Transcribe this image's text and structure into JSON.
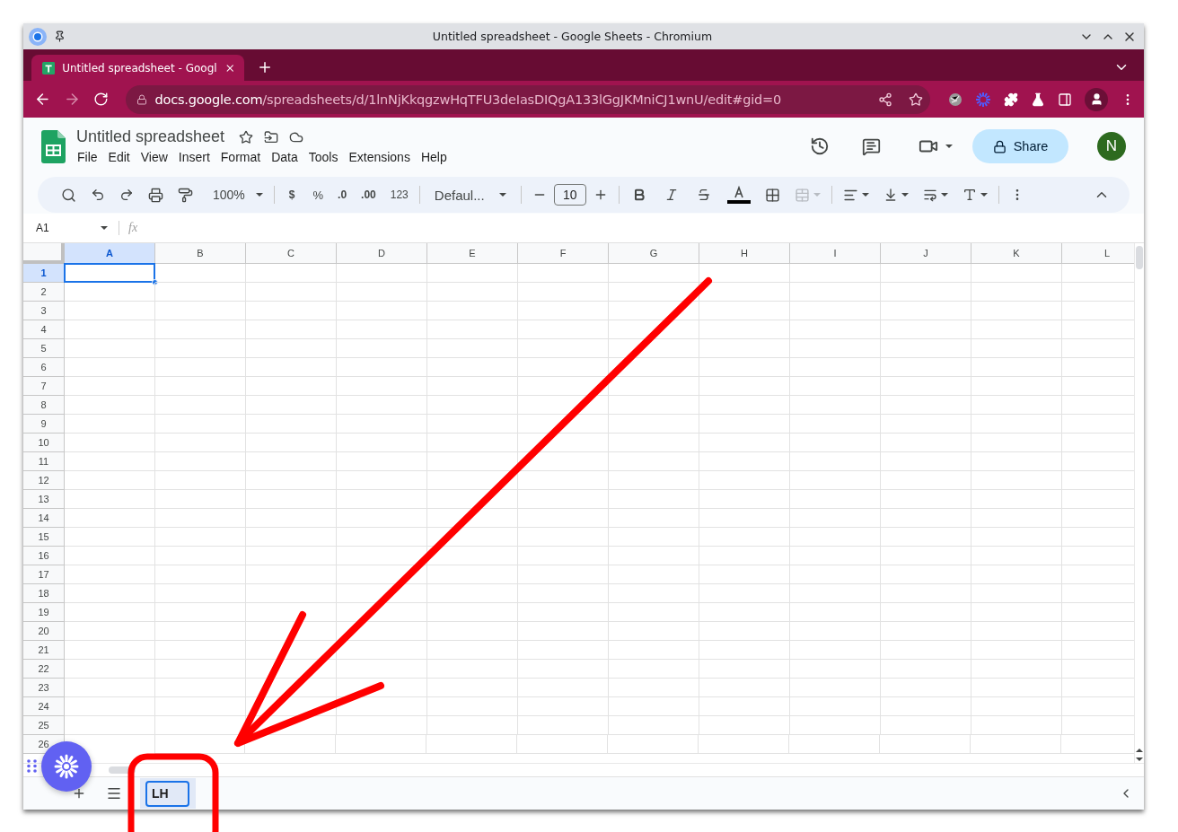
{
  "window": {
    "title": "Untitled spreadsheet - Google Sheets - Chromium"
  },
  "browser": {
    "tab": {
      "title": "Untitled spreadsheet - Googl",
      "selected": true
    },
    "forward": {
      "disabled": true
    },
    "url": {
      "host": "docs.google.com",
      "path": "/spreadsheets/d/1lnNjKkqgzwHqTFU3deIasDIQgA133lGgJKMniCJ1wnU/edit#gid=0"
    }
  },
  "doc": {
    "title": "Untitled spreadsheet",
    "menu": [
      "File",
      "Edit",
      "View",
      "Insert",
      "Format",
      "Data",
      "Tools",
      "Extensions",
      "Help"
    ],
    "share": "Share",
    "avatar": "N"
  },
  "toolbar": {
    "zoom": "100%",
    "currency": "$",
    "percent": "%",
    "decrease_decimal": ".0",
    "increase_decimal": ".00",
    "more_formats": "123",
    "font": "Defaul...",
    "font_size": "10",
    "merge": {
      "disabled": true
    }
  },
  "formula_bar": {
    "name_box": "A1",
    "fx": "fx"
  },
  "columns": [
    {
      "label": "A",
      "selected": true
    },
    {
      "label": "B",
      "selected": false
    },
    {
      "label": "C",
      "selected": false
    },
    {
      "label": "D",
      "selected": false
    },
    {
      "label": "E",
      "selected": false
    },
    {
      "label": "F",
      "selected": false
    },
    {
      "label": "G",
      "selected": false
    },
    {
      "label": "H",
      "selected": false
    },
    {
      "label": "I",
      "selected": false
    },
    {
      "label": "J",
      "selected": false
    },
    {
      "label": "K",
      "selected": false
    },
    {
      "label": "L",
      "selected": false
    }
  ],
  "rows": [
    {
      "label": "1",
      "selected": true
    },
    {
      "label": "2",
      "selected": false
    },
    {
      "label": "3",
      "selected": false
    },
    {
      "label": "4",
      "selected": false
    },
    {
      "label": "5",
      "selected": false
    },
    {
      "label": "6",
      "selected": false
    },
    {
      "label": "7",
      "selected": false
    },
    {
      "label": "8",
      "selected": false
    },
    {
      "label": "9",
      "selected": false
    },
    {
      "label": "10",
      "selected": false
    },
    {
      "label": "11",
      "selected": false
    },
    {
      "label": "12",
      "selected": false
    },
    {
      "label": "13",
      "selected": false
    },
    {
      "label": "14",
      "selected": false
    },
    {
      "label": "15",
      "selected": false
    },
    {
      "label": "16",
      "selected": false
    },
    {
      "label": "17",
      "selected": false
    },
    {
      "label": "18",
      "selected": false
    },
    {
      "label": "19",
      "selected": false
    },
    {
      "label": "20",
      "selected": false
    },
    {
      "label": "21",
      "selected": false
    },
    {
      "label": "22",
      "selected": false
    },
    {
      "label": "23",
      "selected": false
    },
    {
      "label": "24",
      "selected": false
    },
    {
      "label": "25",
      "selected": false
    },
    {
      "label": "26",
      "selected": false
    }
  ],
  "sheets": [
    {
      "name": "LH",
      "selected": true
    }
  ]
}
